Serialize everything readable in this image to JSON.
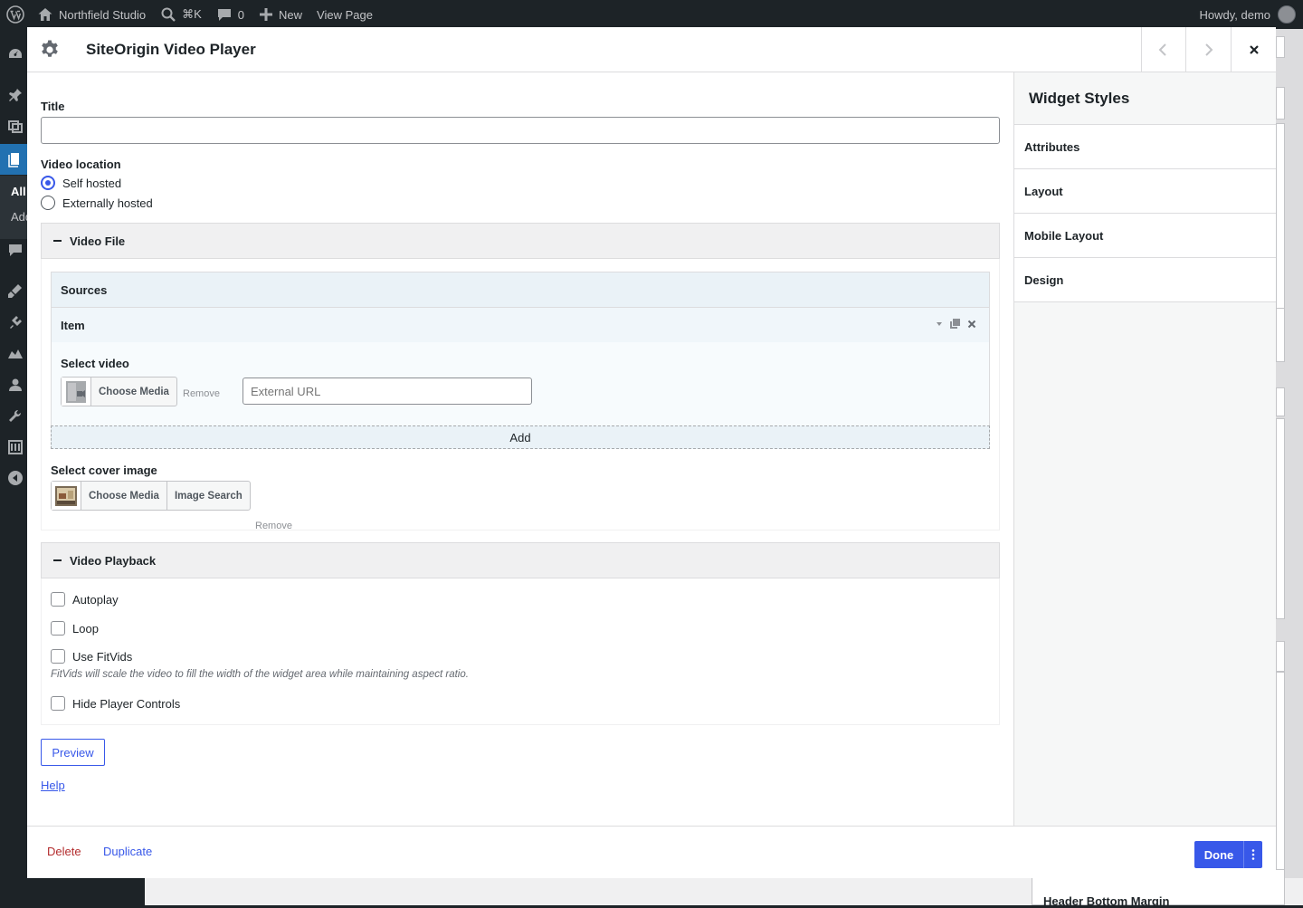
{
  "admin_bar": {
    "site_name": "Northfield Studio",
    "search_shortcut": "⌘K",
    "comments_count": "0",
    "new_label": "New",
    "view_page_label": "View Page",
    "greeting": "Howdy, demo"
  },
  "admin_menu": {
    "sub_items": [
      "All",
      "Add"
    ]
  },
  "dialog": {
    "title": "SiteOrigin Video Player",
    "form": {
      "title_label": "Title",
      "title_value": "",
      "video_location_label": "Video location",
      "location_options": [
        "Self hosted",
        "Externally hosted"
      ],
      "location_selected": "Self hosted",
      "video_file_section": "Video File",
      "sources_label": "Sources",
      "item_label": "Item",
      "select_video_label": "Select video",
      "choose_media_label": "Choose Media",
      "remove_label": "Remove",
      "external_url_placeholder": "External URL",
      "add_label": "Add",
      "cover_image_label": "Select cover image",
      "image_search_label": "Image Search",
      "playback_section": "Video Playback",
      "autoplay_label": "Autoplay",
      "loop_label": "Loop",
      "fitvids_label": "Use FitVids",
      "fitvids_desc": "FitVids will scale the video to fill the width of the widget area while maintaining aspect ratio.",
      "hide_controls_label": "Hide Player Controls",
      "preview_label": "Preview",
      "help_label": "Help"
    },
    "sidebar": {
      "title": "Widget Styles",
      "items": [
        "Attributes",
        "Layout",
        "Mobile Layout",
        "Design"
      ]
    },
    "footer": {
      "delete_label": "Delete",
      "duplicate_label": "Duplicate",
      "done_label": "Done"
    }
  },
  "background": {
    "bottom_peek_text": "Header Bottom Margin"
  },
  "colors": {
    "accent": "#3858e9",
    "danger": "#b32d2e",
    "admin_bar": "#1d2327"
  }
}
